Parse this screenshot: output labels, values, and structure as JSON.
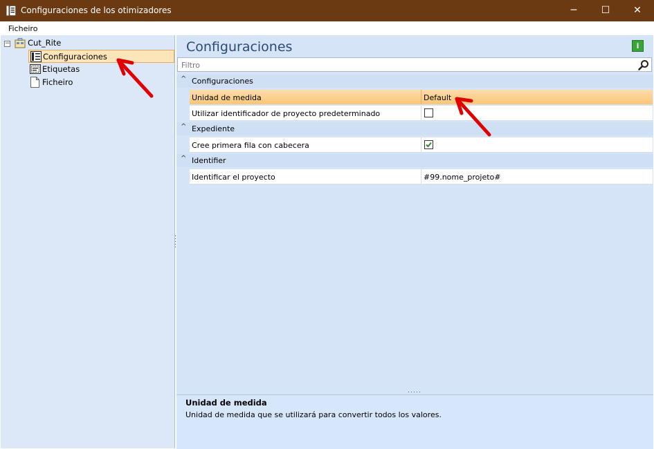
{
  "window": {
    "title": "Configuraciones de los otimizadores",
    "minimize_glyph": "─",
    "maximize_glyph": "☐",
    "close_glyph": "✕"
  },
  "menu": {
    "items": [
      "Ficheiro"
    ]
  },
  "tree": {
    "expander_glyph": "−",
    "root": {
      "label": "Cut_Rite",
      "icon": "project-tree-icon"
    },
    "children": [
      {
        "label": "Configuraciones",
        "icon": "settings-grid-icon",
        "selected": true
      },
      {
        "label": "Etiquetas",
        "icon": "label-icon",
        "selected": false
      },
      {
        "label": "Ficheiro",
        "icon": "document-icon",
        "selected": false
      }
    ]
  },
  "panel": {
    "title": "Configuraciones",
    "info_glyph": "i",
    "filter_placeholder": "Filtro",
    "categories": [
      {
        "label": "Configuraciones",
        "rows": [
          {
            "name": "Unidad de medida",
            "value": "Default",
            "selected": true
          },
          {
            "name": "Utilizar identificador de proyecto predeterminado",
            "checkbox": false
          }
        ]
      },
      {
        "label": "Expediente",
        "rows": [
          {
            "name": "Cree primera fila con cabecera",
            "checkbox": true
          }
        ]
      },
      {
        "label": "Identifier",
        "rows": [
          {
            "name": "Identificar el proyecto",
            "value": "#99.nome_projeto#"
          }
        ]
      }
    ],
    "collapse_glyph": "^",
    "description": {
      "title": "Unidad de medida",
      "text": "Unidad de medida que se utilizará para convertir todos los valores."
    }
  },
  "colors": {
    "titlebar": "#6b3a12",
    "selection": "#fbc677",
    "pane": "#d5e4f7",
    "annotation_arrow": "#e00000"
  }
}
